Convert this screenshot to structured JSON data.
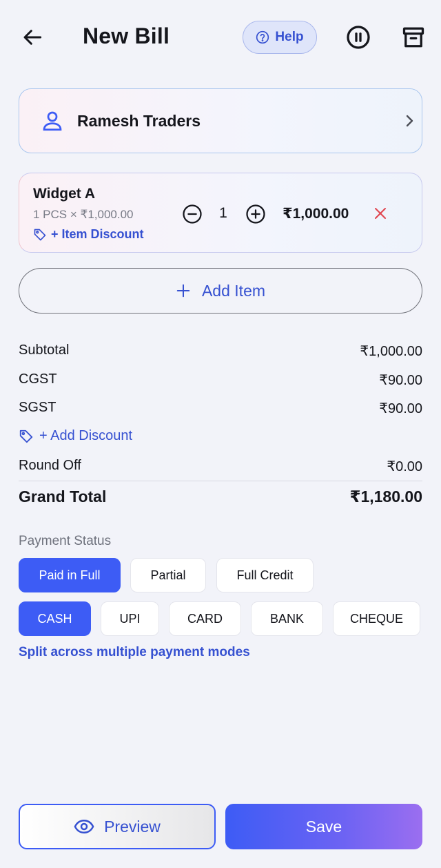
{
  "header": {
    "title": "New Bill",
    "help_label": "Help"
  },
  "customer": {
    "name": "Ramesh Traders"
  },
  "items": [
    {
      "name": "Widget A",
      "meta": "1 PCS × ₹1,000.00",
      "discount_label": "+ Item Discount",
      "quantity": "1",
      "total": "₹1,000.00"
    }
  ],
  "add_item_label": "Add Item",
  "summary": {
    "subtotal_label": "Subtotal",
    "subtotal_value": "₹1,000.00",
    "cgst_label": "CGST",
    "cgst_value": "₹90.00",
    "sgst_label": "SGST",
    "sgst_value": "₹90.00",
    "add_discount_label": "+ Add Discount",
    "round_off_label": "Round Off",
    "round_off_value": "₹0.00",
    "grand_total_label": "Grand Total",
    "grand_total_value": "₹1,180.00"
  },
  "payment": {
    "status_label": "Payment Status",
    "status_options": [
      "Paid in Full",
      "Partial",
      "Full Credit"
    ],
    "status_selected": "Paid in Full",
    "mode_options": [
      "CASH",
      "UPI",
      "CARD",
      "BANK",
      "CHEQUE"
    ],
    "mode_selected": "CASH",
    "split_label": "Split across multiple payment modes"
  },
  "footer": {
    "preview_label": "Preview",
    "save_label": "Save"
  },
  "colors": {
    "accent": "#3d5cf5",
    "link": "#3651d1",
    "remove": "#e0454f",
    "background": "#f2f3f9"
  }
}
